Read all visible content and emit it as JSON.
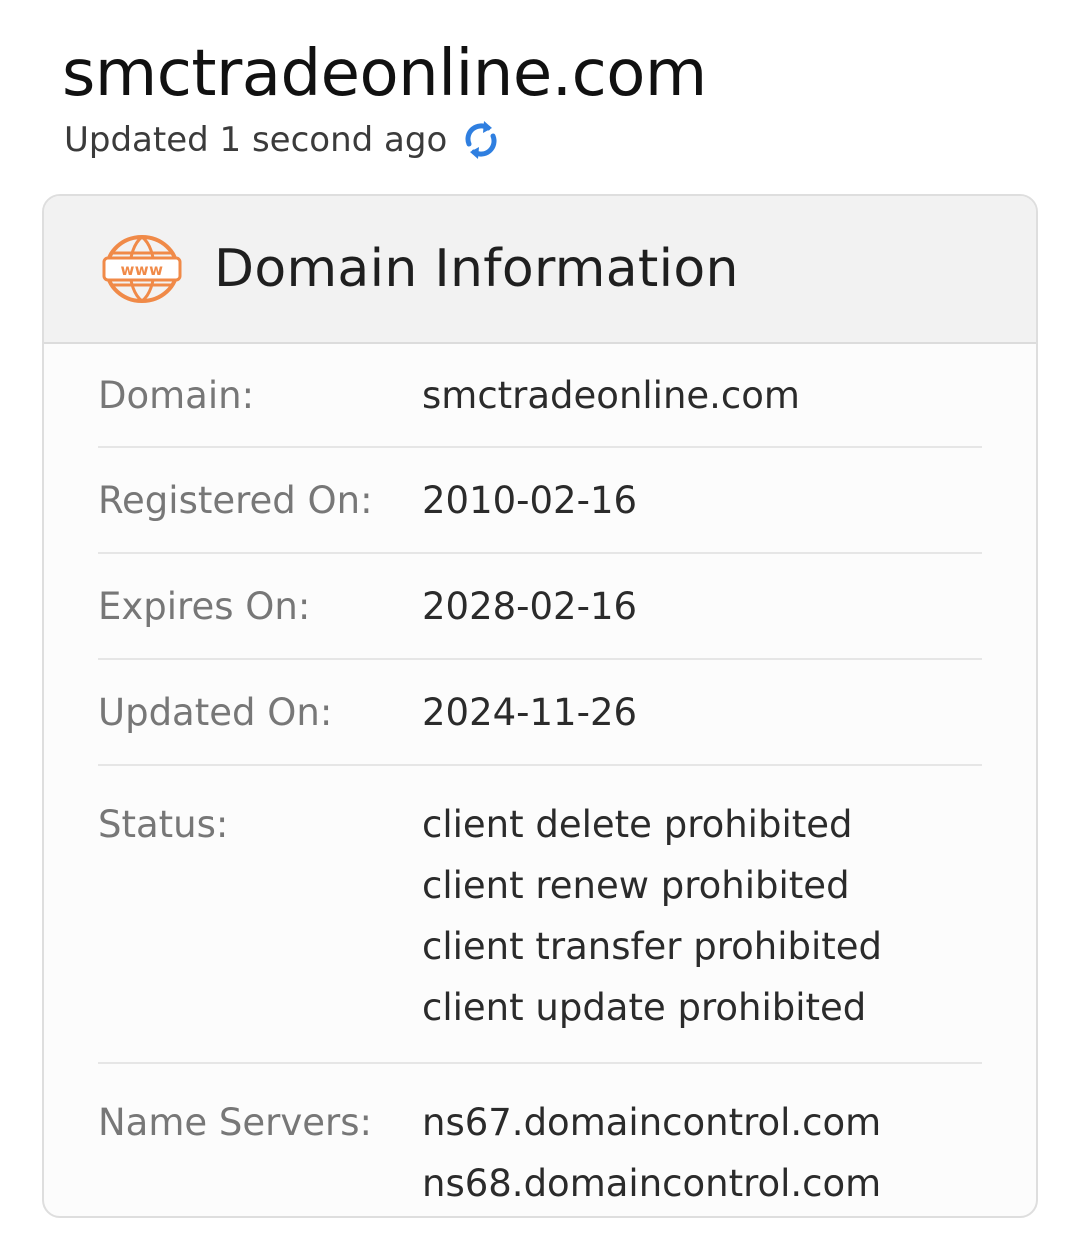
{
  "header": {
    "site_title": "smctradeonline.com",
    "updated_text": "Updated 1 second ago",
    "refresh_icon": "refresh-icon"
  },
  "card": {
    "icon": "www-icon",
    "title": "Domain Information",
    "rows": [
      {
        "label": "Domain:",
        "values": [
          "smctradeonline.com"
        ]
      },
      {
        "label": "Registered On:",
        "values": [
          "2010-02-16"
        ]
      },
      {
        "label": "Expires On:",
        "values": [
          "2028-02-16"
        ]
      },
      {
        "label": "Updated On:",
        "values": [
          "2024-11-26"
        ]
      },
      {
        "label": "Status:",
        "values": [
          "client delete prohibited",
          "client renew prohibited",
          "client transfer prohibited",
          "client update prohibited"
        ]
      },
      {
        "label": "Name Servers:",
        "values": [
          "ns67.domaincontrol.com",
          "ns68.domaincontrol.com"
        ]
      }
    ]
  },
  "colors": {
    "accent_orange": "#F08A48",
    "refresh_blue": "#2F7FE0"
  }
}
